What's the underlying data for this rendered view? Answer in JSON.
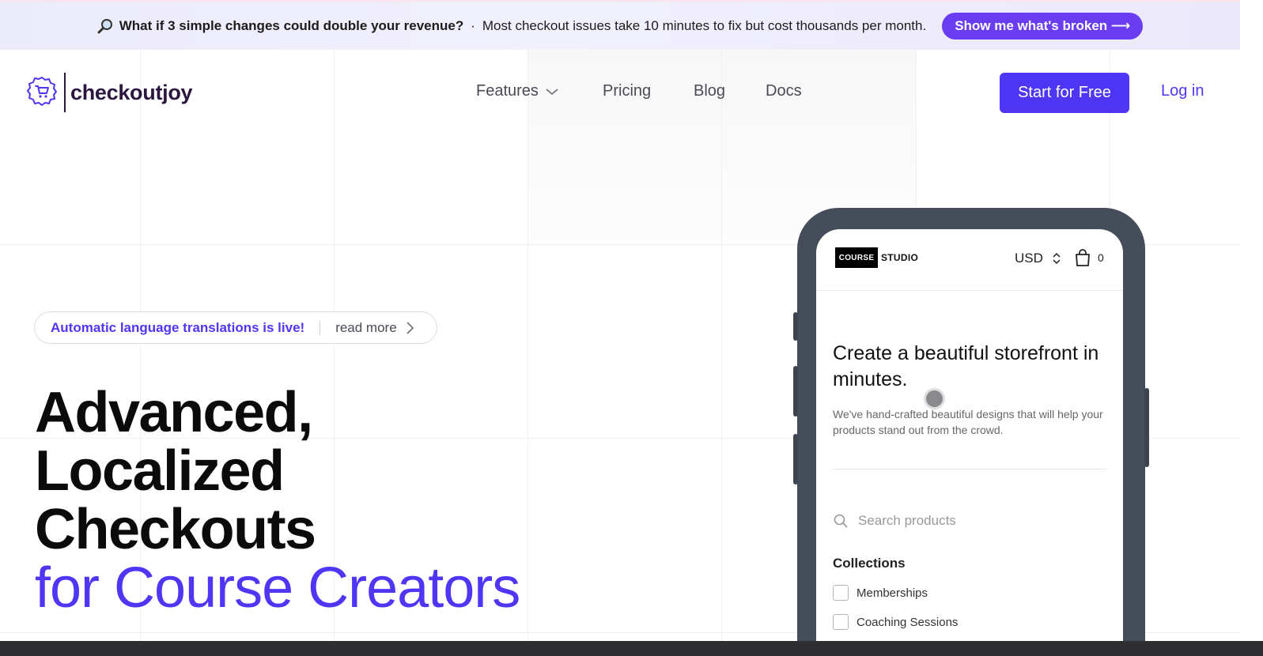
{
  "announcement": {
    "icon": "magnifier-icon",
    "question": "What if 3 simple changes could double your revenue?",
    "separator": "·",
    "message": "Most checkout issues take 10 minutes to fix but cost thousands per month.",
    "cta_label": "Show me what's broken ⟶"
  },
  "header": {
    "logo_text": "checkoutjoy",
    "nav": {
      "features": "Features",
      "pricing": "Pricing",
      "blog": "Blog",
      "docs": "Docs"
    },
    "start_label": "Start for Free",
    "login_label": "Log in"
  },
  "hero": {
    "pill_highlight": "Automatic language translations is live!",
    "pill_link": "read more",
    "headline_lines": [
      "Advanced,",
      "Localized",
      "Checkouts"
    ],
    "headline_accent": "for Course Creators"
  },
  "phone": {
    "brand_box": "COURSE",
    "brand_word": "STUDIO",
    "currency": "USD",
    "cart_count": "0",
    "title": "Create a beautiful storefront in minutes.",
    "description": "We've hand-crafted beautiful designs that will help your products stand out from the crowd.",
    "search_placeholder": "Search products",
    "collections_title": "Collections",
    "collections": [
      "Memberships",
      "Coaching Sessions"
    ]
  },
  "colors": {
    "brand_purple": "#4f36f5",
    "cta_purple": "#6a3df2",
    "phone_frame": "#454d5b"
  }
}
